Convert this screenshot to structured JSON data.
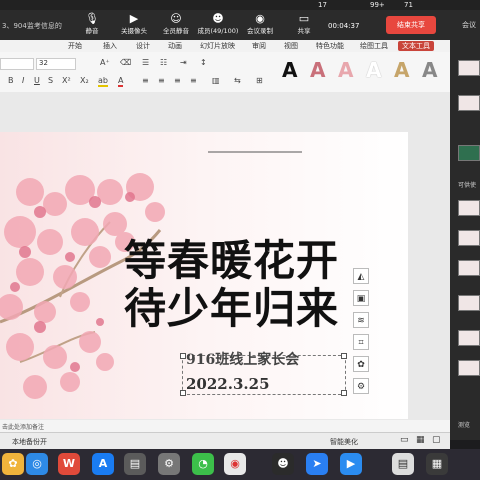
{
  "menubar": {
    "battery": "99+",
    "notifications": "17",
    "count": "71"
  },
  "meeting": {
    "doc_title": "3、904监考信息的",
    "mute": "静音",
    "camera": "关摄像头",
    "mute_all": "全员静音",
    "members": "成员(49/100)",
    "record": "会议录制",
    "share": "共享",
    "timer": "00:04:37",
    "end_share": "结束共享"
  },
  "ribbon": {
    "tabs": [
      "开始",
      "插入",
      "设计",
      "动画",
      "幻灯片放映",
      "审阅",
      "视图",
      "特色功能",
      "绘图工具",
      "文本工具"
    ]
  },
  "toolbar": {
    "font_size": "32",
    "style_letter": "A"
  },
  "slide": {
    "title_line1": "等春暖花开",
    "title_line2": "待少年归来",
    "subtitle": "916班线上家长会",
    "date": "2022.3.25"
  },
  "notes": {
    "text": "击此处添加备注"
  },
  "status": {
    "backup": "本地备份开",
    "beautify": "智能美化"
  },
  "right_panel": {
    "title": "会议",
    "label1": "可供使",
    "label2": "测览"
  }
}
